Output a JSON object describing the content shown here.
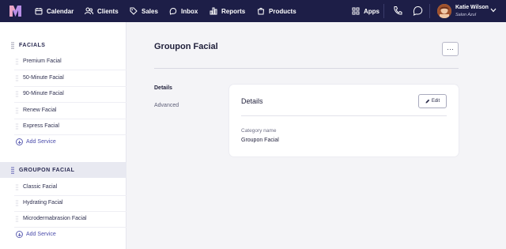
{
  "nav": {
    "items": [
      {
        "label": "Calendar",
        "icon": "calendar-icon"
      },
      {
        "label": "Clients",
        "icon": "clients-icon"
      },
      {
        "label": "Sales",
        "icon": "tag-icon"
      },
      {
        "label": "Inbox",
        "icon": "inbox-icon"
      },
      {
        "label": "Reports",
        "icon": "bar-chart-icon"
      },
      {
        "label": "Products",
        "icon": "bag-icon"
      }
    ],
    "apps_label": "Apps",
    "user": {
      "name": "Katie Wilson",
      "location": "Salon Azul"
    },
    "colors": {
      "bar": "#1d1e47",
      "text": "#ffffff",
      "accent": "#4b4dab"
    }
  },
  "sidebar": {
    "groups": [
      {
        "title": "FACIALS",
        "active": false,
        "services": [
          "Premium Facial",
          "50-Minute Facial",
          "90-Minute Facial",
          "Renew Facial",
          "Express Facial"
        ],
        "add_label": "Add Service"
      },
      {
        "title": "GROUPON FACIAL",
        "active": true,
        "services": [
          "Classic Facial",
          "Hydrating Facial",
          "Microdermabrasion Facial"
        ],
        "add_label": "Add Service"
      }
    ]
  },
  "main": {
    "title": "Groupon Facial",
    "more_label": "···",
    "tabs": [
      {
        "label": "Details",
        "active": true
      },
      {
        "label": "Advanced",
        "active": false
      }
    ],
    "card": {
      "title": "Details",
      "edit_label": "Edit",
      "field_label": "Category name",
      "field_value": "Groupon Facial"
    }
  }
}
